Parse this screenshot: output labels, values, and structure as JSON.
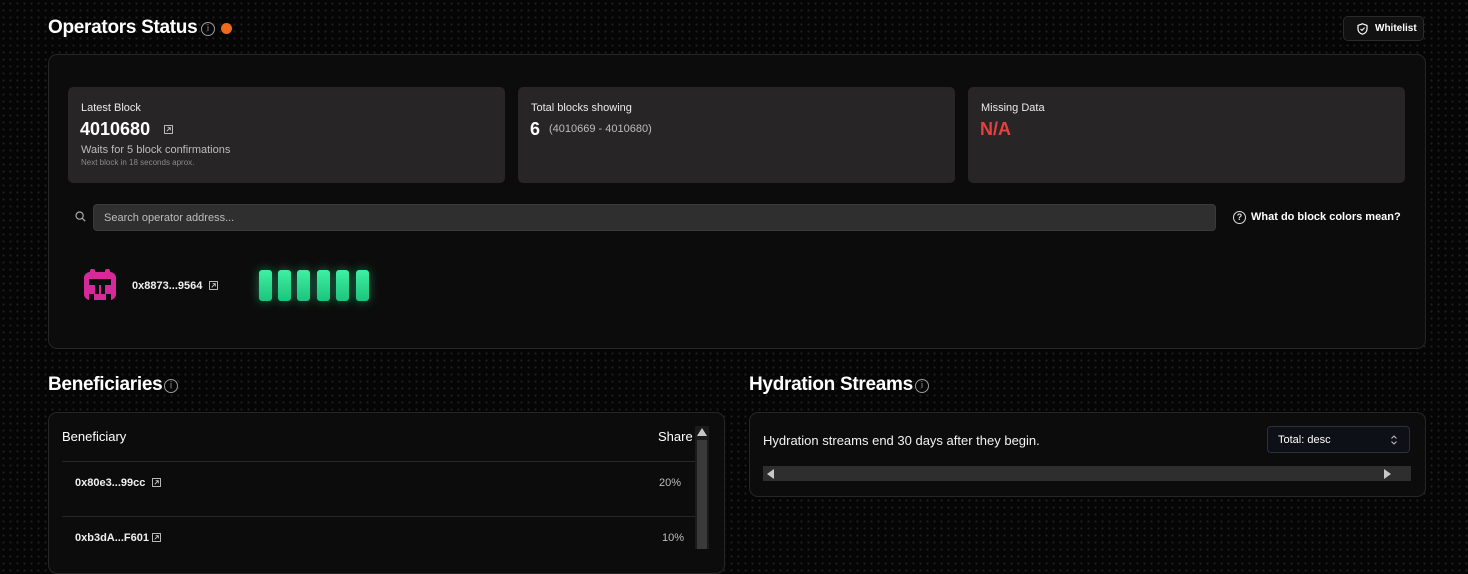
{
  "operators": {
    "title": "Operators Status",
    "status_color": "#f06a1b",
    "whitelist_label": "Whitelist",
    "latest_block": {
      "label": "Latest Block",
      "value": "4010680",
      "confirmations": "Waits for 5 block confirmations",
      "next_block": "Next block in 18 seconds aprox."
    },
    "total_blocks": {
      "label": "Total blocks showing",
      "value": "6",
      "range": "(4010669 - 4010680)"
    },
    "missing_data": {
      "label": "Missing Data",
      "value": "N/A",
      "color": "#e84040"
    },
    "search": {
      "placeholder": "Search operator address..."
    },
    "help_link": "What do block colors mean?",
    "operator": {
      "address": "0x8873...9564",
      "blocks": [
        "valid",
        "valid",
        "valid",
        "valid",
        "valid",
        "valid"
      ],
      "block_color": "#2ee391"
    }
  },
  "beneficiaries": {
    "title": "Beneficiaries",
    "col_beneficiary": "Beneficiary",
    "col_share": "Share",
    "rows": [
      {
        "address": "0x80e3...99cc",
        "share": "20%"
      },
      {
        "address": "0xb3dA...F601",
        "share": "10%"
      }
    ]
  },
  "hydration": {
    "title": "Hydration Streams",
    "description": "Hydration streams end 30 days after they begin.",
    "sort": "Total: desc"
  }
}
